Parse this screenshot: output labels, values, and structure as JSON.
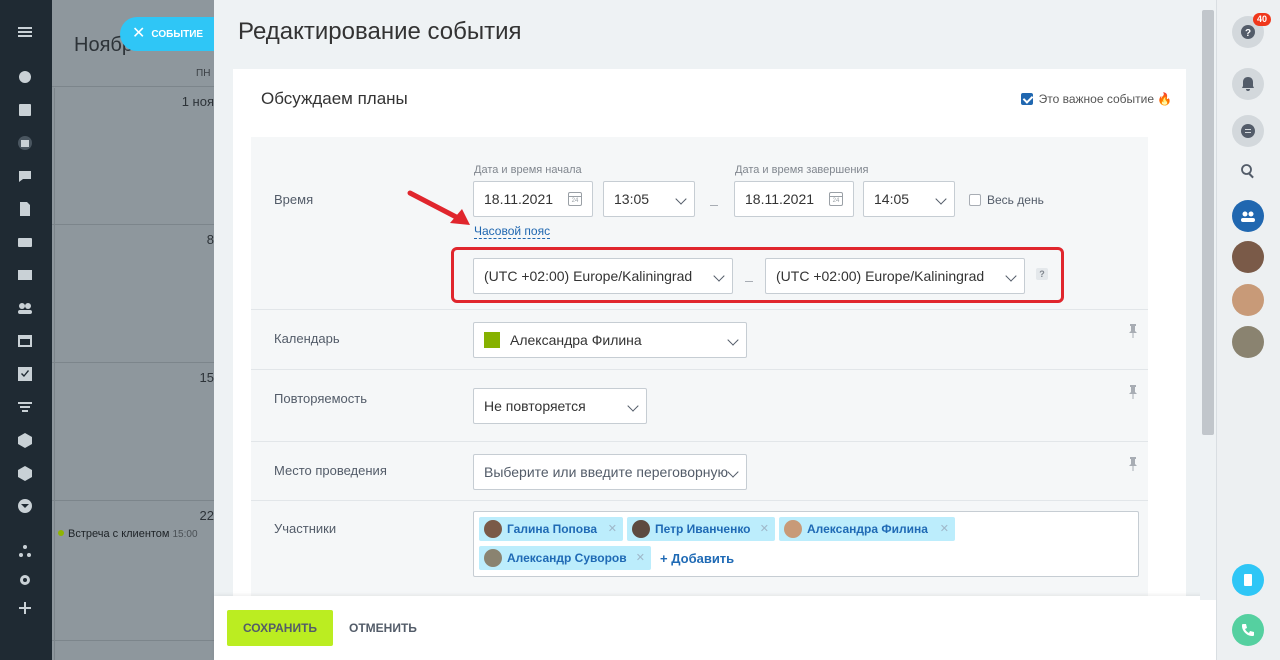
{
  "background_calendar": {
    "title": "Ноябр",
    "day_of_week": "ПН",
    "days": [
      "1 ноя",
      "8",
      "15",
      "22"
    ],
    "event": {
      "name": "Встреча с клиентом",
      "time": "15:00"
    }
  },
  "close_pill": {
    "label": "СОБЫТИЕ"
  },
  "panel": {
    "title": "Редактирование события",
    "event_name": "Обсуждаем планы",
    "important_label": "Это важное событие",
    "important_checked": true
  },
  "time": {
    "label": "Время",
    "start_label": "Дата и время начала",
    "end_label": "Дата и время завершения",
    "start_date": "18.11.2021",
    "start_time": "13:05",
    "end_date": "18.11.2021",
    "end_time": "14:05",
    "all_day_label": "Весь день",
    "timezone_link": "Часовой пояс",
    "timezone_start": "(UTC +02:00) Europe/Kaliningrad",
    "timezone_end": "(UTC +02:00) Europe/Kaliningrad",
    "help": "?"
  },
  "calendar": {
    "label": "Календарь",
    "value": "Александра Филина",
    "color": "#86b100"
  },
  "repeat": {
    "label": "Повторяемость",
    "value": "Не повторяется"
  },
  "location": {
    "label": "Место проведения",
    "placeholder": "Выберите или введите переговорную"
  },
  "attendees": {
    "label": "Участники",
    "people": [
      "Галина Попова",
      "Петр Иванченко",
      "Александра Филина",
      "Александр Суворов"
    ],
    "add_label": "+ Добавить"
  },
  "footer": {
    "save_label": "СОХРАНИТЬ",
    "cancel_label": "ОТМЕНИТЬ"
  },
  "rightbar": {
    "help_badge": "40"
  }
}
